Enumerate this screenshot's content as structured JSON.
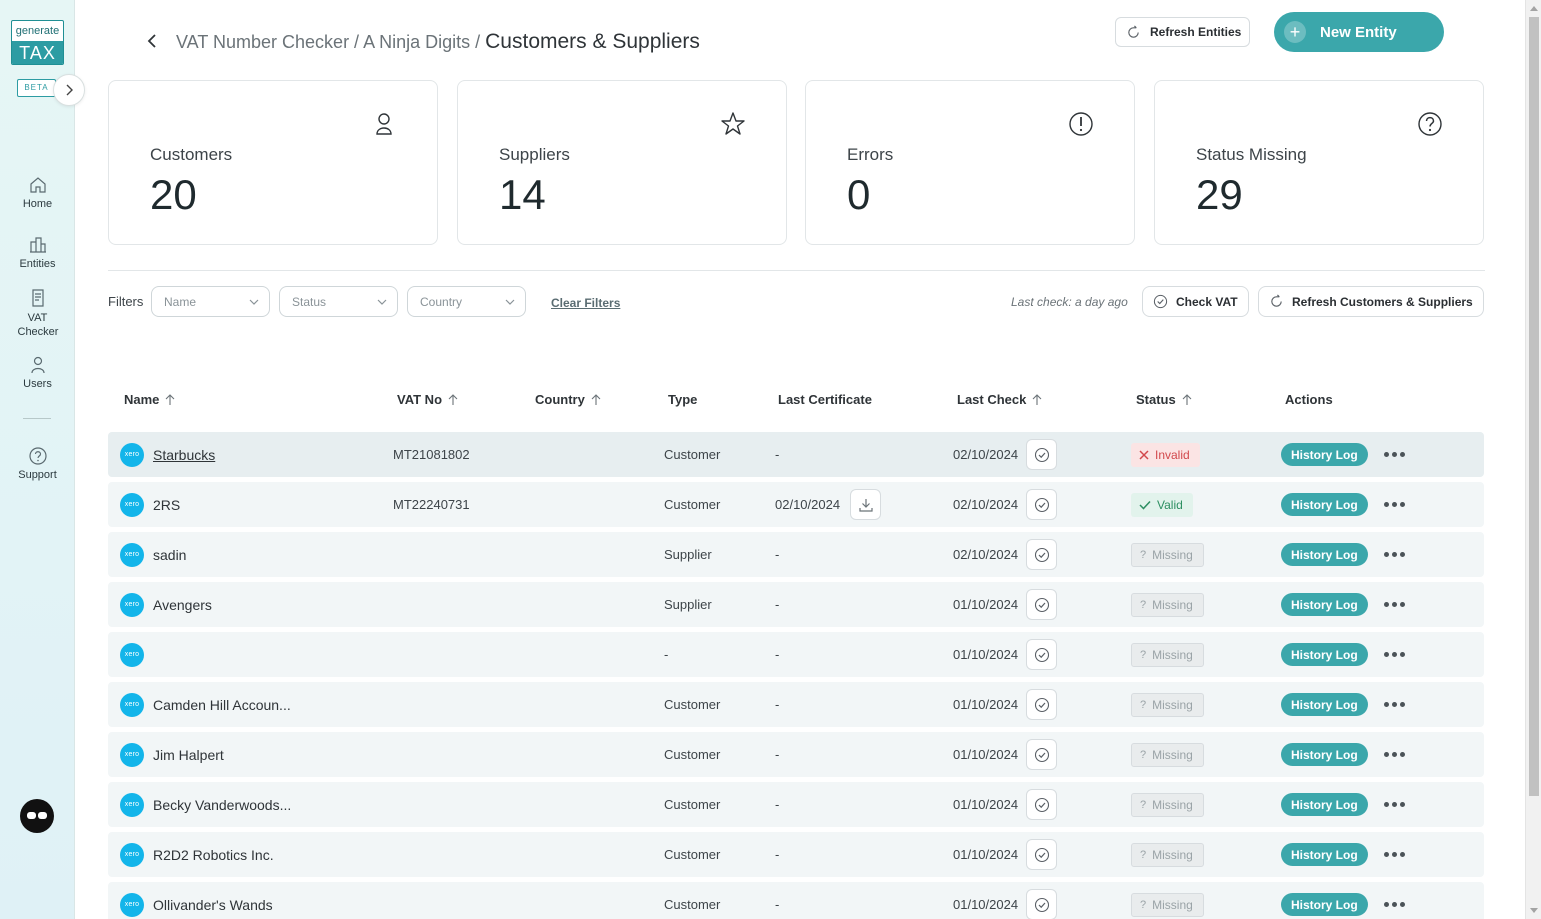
{
  "sidebar": {
    "logo_top": "generate",
    "logo_bottom": "TAX",
    "beta": "BETA",
    "items": [
      {
        "label": "Home",
        "icon": "home-icon"
      },
      {
        "label": "Entities",
        "icon": "buildings-icon"
      },
      {
        "label": "VAT Checker",
        "icon": "document-icon"
      },
      {
        "label": "Users",
        "icon": "user-icon"
      },
      {
        "label": "Support",
        "icon": "help-icon"
      }
    ]
  },
  "header": {
    "breadcrumb_parent": "VAT Number Checker / A Ninja Digits /",
    "breadcrumb_current": "Customers & Suppliers",
    "refresh_entities": "Refresh Entities",
    "new_entity": "New Entity"
  },
  "stats": [
    {
      "label": "Customers",
      "value": "20",
      "icon": "user-icon"
    },
    {
      "label": "Suppliers",
      "value": "14",
      "icon": "star-icon"
    },
    {
      "label": "Errors",
      "value": "0",
      "icon": "alert-icon"
    },
    {
      "label": "Status Missing",
      "value": "29",
      "icon": "question-icon"
    }
  ],
  "filters": {
    "label": "Filters",
    "name_placeholder": "Name",
    "status_placeholder": "Status",
    "country_placeholder": "Country",
    "clear": "Clear Filters",
    "last_check": "Last check: a day ago",
    "check_vat": "Check VAT",
    "refresh_cs": "Refresh Customers & Suppliers"
  },
  "table": {
    "columns": {
      "name": "Name",
      "vat": "VAT No",
      "country": "Country",
      "type": "Type",
      "last_certificate": "Last Certificate",
      "last_check": "Last Check",
      "status": "Status",
      "actions": "Actions"
    },
    "xero_label": "xero",
    "history_label": "History Log",
    "rows": [
      {
        "name": "Starbucks",
        "vat": "MT21081802",
        "country": "",
        "type": "Customer",
        "cert": "-",
        "check": "02/10/2024",
        "status": "Invalid",
        "status_kind": "invalid"
      },
      {
        "name": "2RS",
        "vat": "MT22240731",
        "country": "",
        "type": "Customer",
        "cert": "02/10/2024",
        "check": "02/10/2024",
        "status": "Valid",
        "status_kind": "valid"
      },
      {
        "name": "sadin",
        "vat": "",
        "country": "",
        "type": "Supplier",
        "cert": "-",
        "check": "02/10/2024",
        "status": "Missing",
        "status_kind": "missing"
      },
      {
        "name": "Avengers",
        "vat": "",
        "country": "",
        "type": "Supplier",
        "cert": "-",
        "check": "01/10/2024",
        "status": "Missing",
        "status_kind": "missing"
      },
      {
        "name": "",
        "vat": "",
        "country": "",
        "type": "-",
        "cert": "-",
        "check": "01/10/2024",
        "status": "Missing",
        "status_kind": "missing"
      },
      {
        "name": "Camden Hill Accoun...",
        "vat": "",
        "country": "",
        "type": "Customer",
        "cert": "-",
        "check": "01/10/2024",
        "status": "Missing",
        "status_kind": "missing"
      },
      {
        "name": "Jim Halpert",
        "vat": "",
        "country": "",
        "type": "Customer",
        "cert": "-",
        "check": "01/10/2024",
        "status": "Missing",
        "status_kind": "missing"
      },
      {
        "name": "Becky Vanderwoods...",
        "vat": "",
        "country": "",
        "type": "Customer",
        "cert": "-",
        "check": "01/10/2024",
        "status": "Missing",
        "status_kind": "missing"
      },
      {
        "name": "R2D2 Robotics Inc.",
        "vat": "",
        "country": "",
        "type": "Customer",
        "cert": "-",
        "check": "01/10/2024",
        "status": "Missing",
        "status_kind": "missing"
      },
      {
        "name": "Ollivander's Wands",
        "vat": "",
        "country": "",
        "type": "Customer",
        "cert": "-",
        "check": "01/10/2024",
        "status": "Missing",
        "status_kind": "missing"
      }
    ]
  },
  "colors": {
    "accent": "#3ba7ab",
    "xero": "#13b5ea",
    "invalid": "#d2484c",
    "valid": "#2d8f62"
  }
}
